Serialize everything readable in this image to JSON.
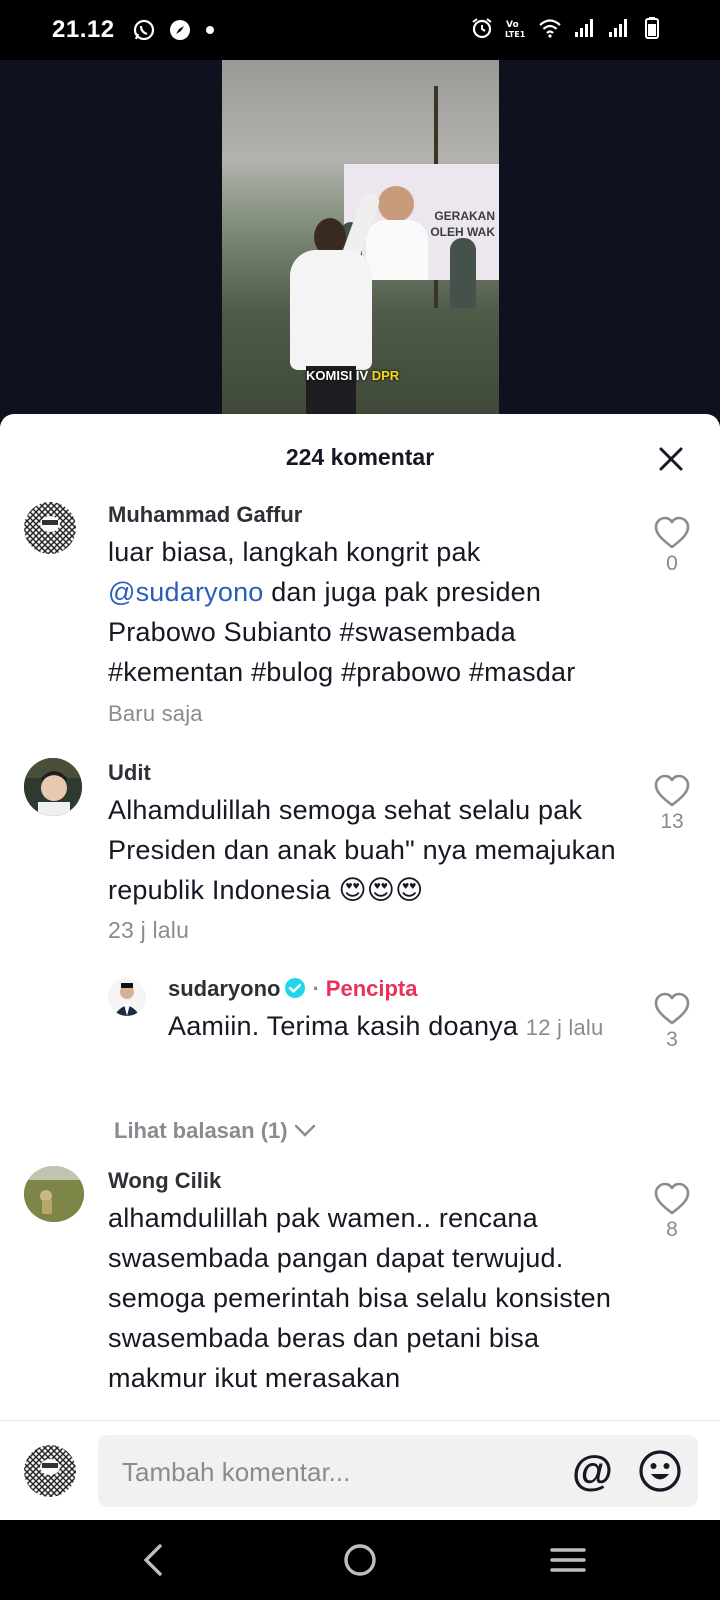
{
  "status_bar": {
    "time": "21.12",
    "icons_left": [
      "whatsapp-icon",
      "compass-icon",
      "notification-dot"
    ],
    "icons_right": [
      "alarm-icon",
      "volte-icon",
      "wifi-icon",
      "signal-icon",
      "signal-icon",
      "battery-icon"
    ],
    "volte_label": "Vo LTE1"
  },
  "video": {
    "billboard_text": "GERAKAN\nOLEH WAK",
    "caption_part1": "KOMISI IV ",
    "caption_part2": "DPR"
  },
  "sheet": {
    "title": "224 komentar"
  },
  "comments": [
    {
      "name": "Muhammad Gaffur",
      "text_before": "luar biasa, langkah kongrit pak ",
      "mention": "@sudaryono",
      "text_after": " dan juga pak presiden Prabowo Subianto #swasembada #kementan #bulog #prabowo #masdar ",
      "time": "Baru saja",
      "likes": "0"
    },
    {
      "name": "Udit",
      "text": "Alhamdulillah semoga sehat selalu pak Presiden dan anak buah\" nya memajukan republik Indonesia 😍😍😍",
      "time": "23 j lalu",
      "likes": "13"
    },
    {
      "name": "Wong Cilik",
      "text": "alhamdulillah pak wamen.. rencana swasembada pangan dapat terwujud. semoga pemerintah bisa selalu konsisten swasembada beras dan petani bisa makmur ikut merasakan",
      "likes": "8"
    }
  ],
  "reply": {
    "name": "sudaryono",
    "separator": "·",
    "badge": "Pencipta",
    "text": "Aamiin. Terima kasih doanya ",
    "time": "12 j lalu",
    "likes": "3"
  },
  "view_replies": "Lihat balasan (1)",
  "input": {
    "placeholder": "Tambah komentar...",
    "mention_symbol": "@"
  },
  "colors": {
    "mention": "#2b5db9",
    "creator": "#e8325c",
    "verified": "#20d5ec",
    "muted": "#8a8b91"
  }
}
